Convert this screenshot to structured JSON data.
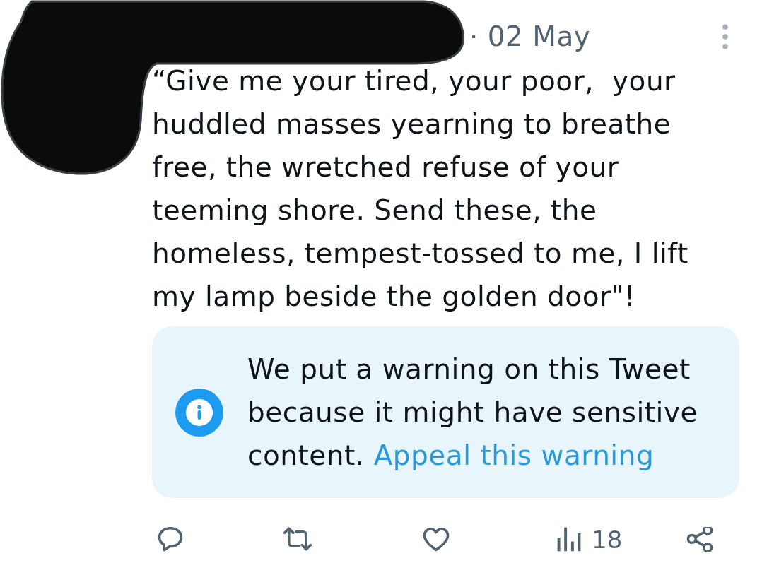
{
  "tweet": {
    "timestamp": "· 02 May",
    "text": "“Give me your tired, your poor,  your huddled masses yearning to breathe free, the wretched refuse of your teeming shore. Send these, the homeless, tempest-tossed to me, I lift my lamp beside the golden door\"!",
    "warning": {
      "message": "We put a warning on this Tweet because it might have sensitive content.",
      "link": "Appeal this warning"
    },
    "actions": [
      {
        "kind": "reply"
      },
      {
        "kind": "retweet"
      },
      {
        "kind": "like"
      },
      {
        "kind": "views",
        "count": "18"
      },
      {
        "kind": "share"
      }
    ]
  }
}
